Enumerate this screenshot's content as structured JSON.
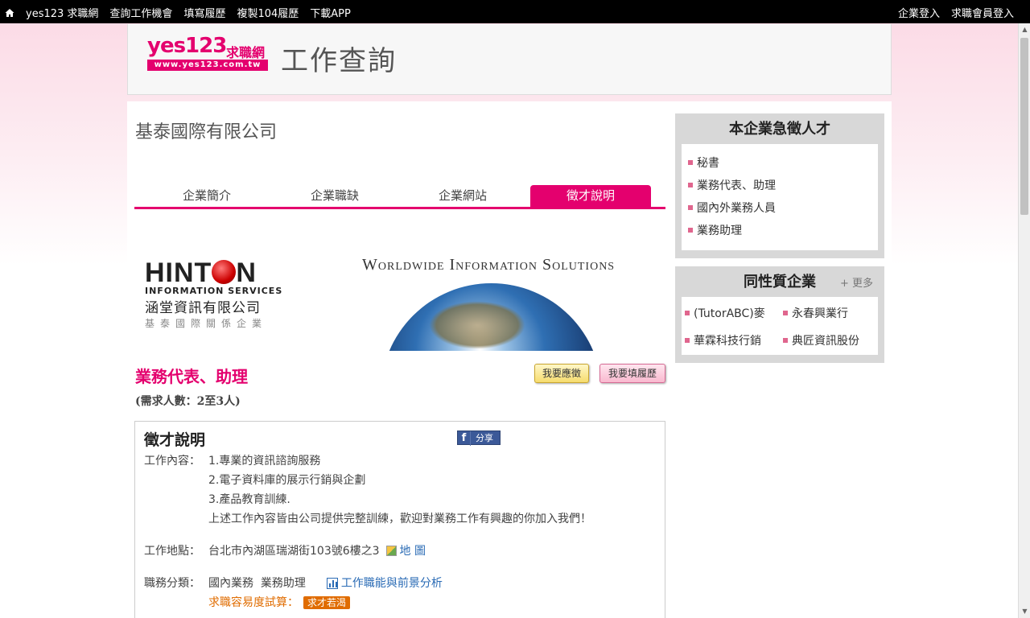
{
  "topnav": {
    "site": "yes123 求職網",
    "items": [
      "查詢工作機會",
      "填寫履歷",
      "複製104履歷",
      "下載APP"
    ],
    "right": [
      "企業登入",
      "求職會員登入"
    ]
  },
  "header": {
    "logo_main": "yes123",
    "logo_zh": "求職網",
    "logo_url": "www.yes123.com.tw",
    "page_title": "工作查詢"
  },
  "company": {
    "name": "基泰國際有限公司"
  },
  "tabs": [
    "企業簡介",
    "企業職缺",
    "企業網站",
    "徵才說明"
  ],
  "banner": {
    "logo_left": "HINT",
    "logo_right": "N",
    "logo_sub": "INFORMATION SERVICES",
    "logo_cn": "涵堂資訊有限公司",
    "logo_cn2": "基泰國際關係企業",
    "slogan": "Worldwide Information Solutions"
  },
  "job": {
    "title": "業務代表、助理",
    "apply_button": "我要應徵",
    "resume_button": "我要填履歷",
    "headcount": "(需求人數：2至3人)"
  },
  "description": {
    "title": "徵才說明",
    "share_label": "分享",
    "content_label": "工作內容：",
    "content_lines": [
      "1.專業的資訊諮詢服務",
      "2.電子資料庫的展示行銷與企劃",
      "3.產品教育訓練.",
      "上述工作內容皆由公司提供完整訓練，歡迎對業務工作有興趣的你加入我們！"
    ],
    "location_label": "工作地點：",
    "location": "台北市內湖區瑞湖街103號6樓之3",
    "map_link": "地 圖",
    "category_label": "職務分類：",
    "categories": "國內業務  業務助理",
    "analysis_link": "工作職能與前景分析",
    "difficulty_label": "求職容易度試算：",
    "difficulty_badge": "求才若渴"
  },
  "urgent": {
    "title": "本企業急徵人才",
    "items": [
      "秘書",
      "業務代表、助理",
      "國內外業務人員",
      "業務助理"
    ]
  },
  "similar": {
    "title": "同性質企業",
    "more": "+ 更多",
    "items": [
      "(TutorABC)麥",
      "永春興業行",
      "華霖科技行銷",
      "典匠資訊股份"
    ]
  }
}
